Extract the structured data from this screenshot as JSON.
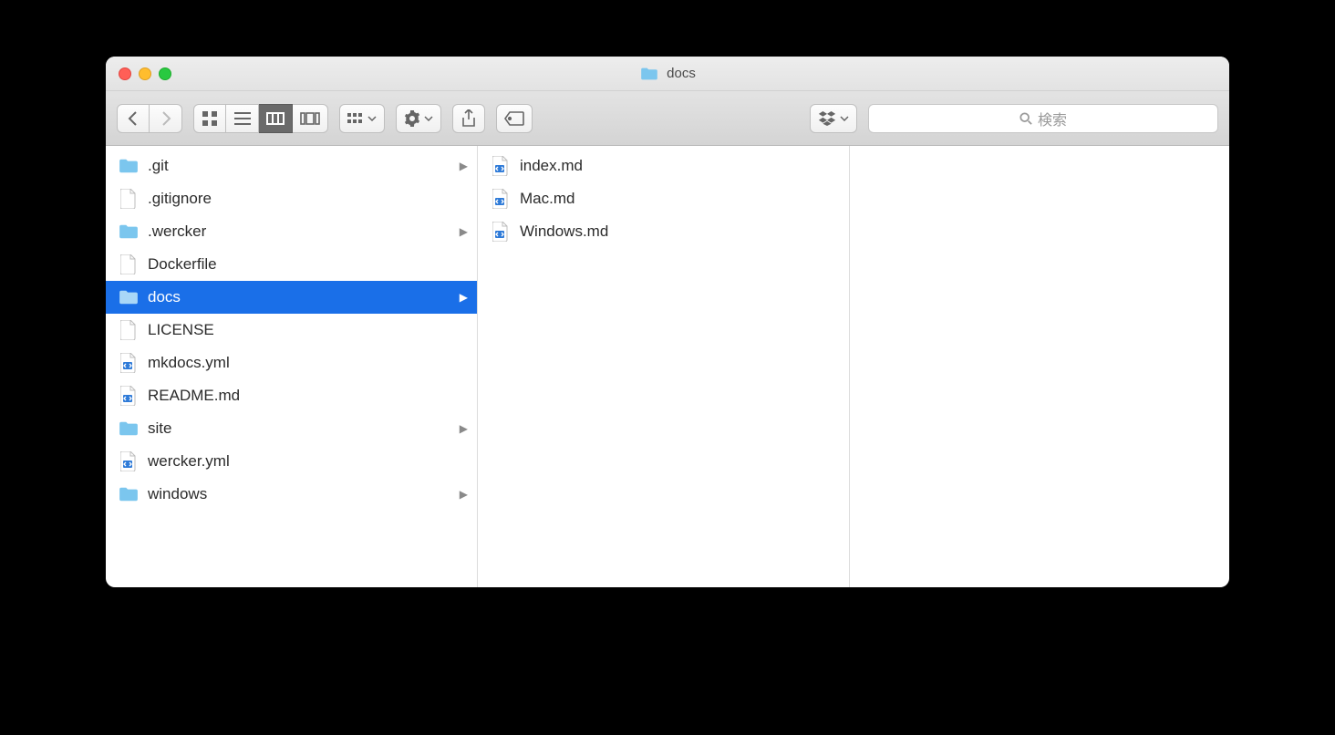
{
  "window": {
    "title": "docs"
  },
  "toolbar": {
    "search_placeholder": "検索"
  },
  "columns": [
    {
      "items": [
        {
          "name": ".git",
          "kind": "folder",
          "hasChildren": true,
          "selected": false
        },
        {
          "name": ".gitignore",
          "kind": "file",
          "hasChildren": false,
          "selected": false
        },
        {
          "name": ".wercker",
          "kind": "folder",
          "hasChildren": true,
          "selected": false
        },
        {
          "name": "Dockerfile",
          "kind": "file",
          "hasChildren": false,
          "selected": false
        },
        {
          "name": "docs",
          "kind": "folder",
          "hasChildren": true,
          "selected": true
        },
        {
          "name": "LICENSE",
          "kind": "file",
          "hasChildren": false,
          "selected": false
        },
        {
          "name": "mkdocs.yml",
          "kind": "code",
          "hasChildren": false,
          "selected": false
        },
        {
          "name": "README.md",
          "kind": "code",
          "hasChildren": false,
          "selected": false
        },
        {
          "name": "site",
          "kind": "folder",
          "hasChildren": true,
          "selected": false
        },
        {
          "name": "wercker.yml",
          "kind": "code",
          "hasChildren": false,
          "selected": false
        },
        {
          "name": "windows",
          "kind": "folder",
          "hasChildren": true,
          "selected": false
        }
      ]
    },
    {
      "items": [
        {
          "name": "index.md",
          "kind": "code",
          "hasChildren": false,
          "selected": false
        },
        {
          "name": "Mac.md",
          "kind": "code",
          "hasChildren": false,
          "selected": false
        },
        {
          "name": "Windows.md",
          "kind": "code",
          "hasChildren": false,
          "selected": false
        }
      ]
    },
    {
      "items": []
    }
  ]
}
